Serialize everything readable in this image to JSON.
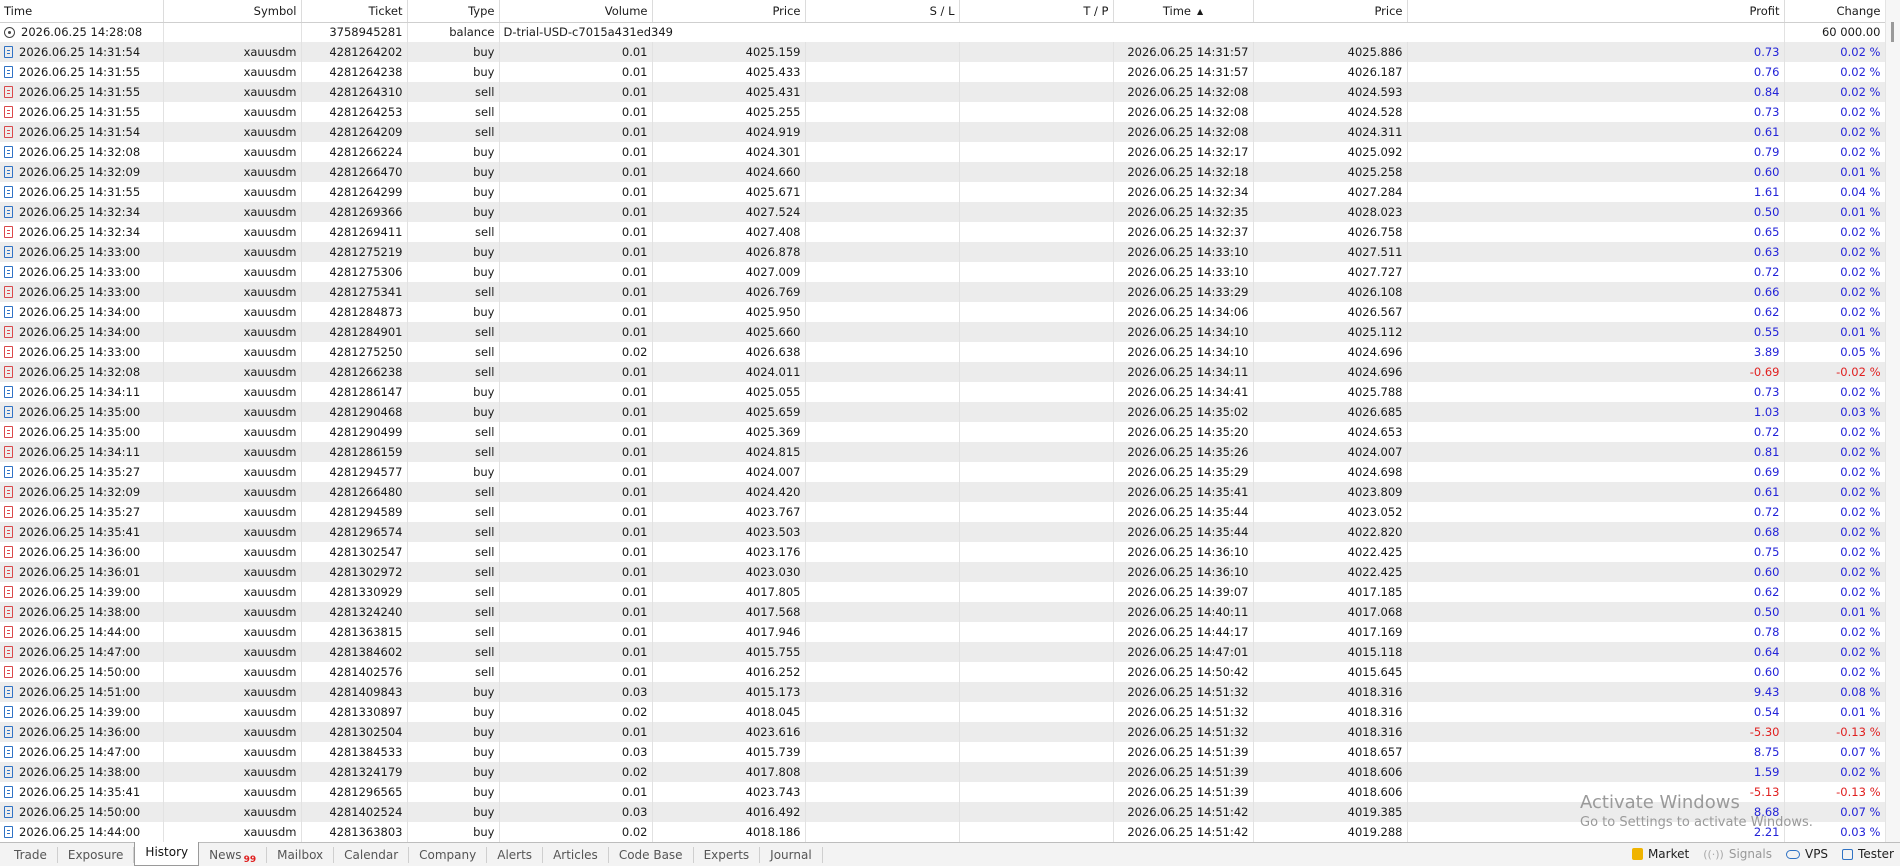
{
  "columns": [
    "Time",
    "Symbol",
    "Ticket",
    "Type",
    "Volume",
    "Price",
    "S / L",
    "T / P",
    "Time",
    "Price",
    "Profit",
    "Change"
  ],
  "sort_indicator": "▲",
  "balance_row": {
    "time": "2026.06.25 14:28:08",
    "ticket": "3758945281",
    "type": "balance",
    "comment": "D-trial-USD-c7015a431ed349",
    "profit": "60 000.00"
  },
  "deals": [
    {
      "open_time": "2026.06.25 14:31:54",
      "symbol": "xauusdm",
      "ticket": "4281264202",
      "type": "buy",
      "volume": "0.01",
      "open_price": "4025.159",
      "sl": "",
      "tp": "",
      "close_time": "2026.06.25 14:31:57",
      "close_price": "4025.886",
      "profit": "0.73",
      "change": "0.02 %"
    },
    {
      "open_time": "2026.06.25 14:31:55",
      "symbol": "xauusdm",
      "ticket": "4281264238",
      "type": "buy",
      "volume": "0.01",
      "open_price": "4025.433",
      "sl": "",
      "tp": "",
      "close_time": "2026.06.25 14:31:57",
      "close_price": "4026.187",
      "profit": "0.76",
      "change": "0.02 %"
    },
    {
      "open_time": "2026.06.25 14:31:55",
      "symbol": "xauusdm",
      "ticket": "4281264310",
      "type": "sell",
      "volume": "0.01",
      "open_price": "4025.431",
      "sl": "",
      "tp": "",
      "close_time": "2026.06.25 14:32:08",
      "close_price": "4024.593",
      "profit": "0.84",
      "change": "0.02 %"
    },
    {
      "open_time": "2026.06.25 14:31:55",
      "symbol": "xauusdm",
      "ticket": "4281264253",
      "type": "sell",
      "volume": "0.01",
      "open_price": "4025.255",
      "sl": "",
      "tp": "",
      "close_time": "2026.06.25 14:32:08",
      "close_price": "4024.528",
      "profit": "0.73",
      "change": "0.02 %"
    },
    {
      "open_time": "2026.06.25 14:31:54",
      "symbol": "xauusdm",
      "ticket": "4281264209",
      "type": "sell",
      "volume": "0.01",
      "open_price": "4024.919",
      "sl": "",
      "tp": "",
      "close_time": "2026.06.25 14:32:08",
      "close_price": "4024.311",
      "profit": "0.61",
      "change": "0.02 %"
    },
    {
      "open_time": "2026.06.25 14:32:08",
      "symbol": "xauusdm",
      "ticket": "4281266224",
      "type": "buy",
      "volume": "0.01",
      "open_price": "4024.301",
      "sl": "",
      "tp": "",
      "close_time": "2026.06.25 14:32:17",
      "close_price": "4025.092",
      "profit": "0.79",
      "change": "0.02 %"
    },
    {
      "open_time": "2026.06.25 14:32:09",
      "symbol": "xauusdm",
      "ticket": "4281266470",
      "type": "buy",
      "volume": "0.01",
      "open_price": "4024.660",
      "sl": "",
      "tp": "",
      "close_time": "2026.06.25 14:32:18",
      "close_price": "4025.258",
      "profit": "0.60",
      "change": "0.01 %"
    },
    {
      "open_time": "2026.06.25 14:31:55",
      "symbol": "xauusdm",
      "ticket": "4281264299",
      "type": "buy",
      "volume": "0.01",
      "open_price": "4025.671",
      "sl": "",
      "tp": "",
      "close_time": "2026.06.25 14:32:34",
      "close_price": "4027.284",
      "profit": "1.61",
      "change": "0.04 %"
    },
    {
      "open_time": "2026.06.25 14:32:34",
      "symbol": "xauusdm",
      "ticket": "4281269366",
      "type": "buy",
      "volume": "0.01",
      "open_price": "4027.524",
      "sl": "",
      "tp": "",
      "close_time": "2026.06.25 14:32:35",
      "close_price": "4028.023",
      "profit": "0.50",
      "change": "0.01 %"
    },
    {
      "open_time": "2026.06.25 14:32:34",
      "symbol": "xauusdm",
      "ticket": "4281269411",
      "type": "sell",
      "volume": "0.01",
      "open_price": "4027.408",
      "sl": "",
      "tp": "",
      "close_time": "2026.06.25 14:32:37",
      "close_price": "4026.758",
      "profit": "0.65",
      "change": "0.02 %"
    },
    {
      "open_time": "2026.06.25 14:33:00",
      "symbol": "xauusdm",
      "ticket": "4281275219",
      "type": "buy",
      "volume": "0.01",
      "open_price": "4026.878",
      "sl": "",
      "tp": "",
      "close_time": "2026.06.25 14:33:10",
      "close_price": "4027.511",
      "profit": "0.63",
      "change": "0.02 %"
    },
    {
      "open_time": "2026.06.25 14:33:00",
      "symbol": "xauusdm",
      "ticket": "4281275306",
      "type": "buy",
      "volume": "0.01",
      "open_price": "4027.009",
      "sl": "",
      "tp": "",
      "close_time": "2026.06.25 14:33:10",
      "close_price": "4027.727",
      "profit": "0.72",
      "change": "0.02 %"
    },
    {
      "open_time": "2026.06.25 14:33:00",
      "symbol": "xauusdm",
      "ticket": "4281275341",
      "type": "sell",
      "volume": "0.01",
      "open_price": "4026.769",
      "sl": "",
      "tp": "",
      "close_time": "2026.06.25 14:33:29",
      "close_price": "4026.108",
      "profit": "0.66",
      "change": "0.02 %"
    },
    {
      "open_time": "2026.06.25 14:34:00",
      "symbol": "xauusdm",
      "ticket": "4281284873",
      "type": "buy",
      "volume": "0.01",
      "open_price": "4025.950",
      "sl": "",
      "tp": "",
      "close_time": "2026.06.25 14:34:06",
      "close_price": "4026.567",
      "profit": "0.62",
      "change": "0.02 %"
    },
    {
      "open_time": "2026.06.25 14:34:00",
      "symbol": "xauusdm",
      "ticket": "4281284901",
      "type": "sell",
      "volume": "0.01",
      "open_price": "4025.660",
      "sl": "",
      "tp": "",
      "close_time": "2026.06.25 14:34:10",
      "close_price": "4025.112",
      "profit": "0.55",
      "change": "0.01 %"
    },
    {
      "open_time": "2026.06.25 14:33:00",
      "symbol": "xauusdm",
      "ticket": "4281275250",
      "type": "sell",
      "volume": "0.02",
      "open_price": "4026.638",
      "sl": "",
      "tp": "",
      "close_time": "2026.06.25 14:34:10",
      "close_price": "4024.696",
      "profit": "3.89",
      "change": "0.05 %"
    },
    {
      "open_time": "2026.06.25 14:32:08",
      "symbol": "xauusdm",
      "ticket": "4281266238",
      "type": "sell",
      "volume": "0.01",
      "open_price": "4024.011",
      "sl": "",
      "tp": "",
      "close_time": "2026.06.25 14:34:11",
      "close_price": "4024.696",
      "profit": "-0.69",
      "change": "-0.02 %"
    },
    {
      "open_time": "2026.06.25 14:34:11",
      "symbol": "xauusdm",
      "ticket": "4281286147",
      "type": "buy",
      "volume": "0.01",
      "open_price": "4025.055",
      "sl": "",
      "tp": "",
      "close_time": "2026.06.25 14:34:41",
      "close_price": "4025.788",
      "profit": "0.73",
      "change": "0.02 %"
    },
    {
      "open_time": "2026.06.25 14:35:00",
      "symbol": "xauusdm",
      "ticket": "4281290468",
      "type": "buy",
      "volume": "0.01",
      "open_price": "4025.659",
      "sl": "",
      "tp": "",
      "close_time": "2026.06.25 14:35:02",
      "close_price": "4026.685",
      "profit": "1.03",
      "change": "0.03 %"
    },
    {
      "open_time": "2026.06.25 14:35:00",
      "symbol": "xauusdm",
      "ticket": "4281290499",
      "type": "sell",
      "volume": "0.01",
      "open_price": "4025.369",
      "sl": "",
      "tp": "",
      "close_time": "2026.06.25 14:35:20",
      "close_price": "4024.653",
      "profit": "0.72",
      "change": "0.02 %"
    },
    {
      "open_time": "2026.06.25 14:34:11",
      "symbol": "xauusdm",
      "ticket": "4281286159",
      "type": "sell",
      "volume": "0.01",
      "open_price": "4024.815",
      "sl": "",
      "tp": "",
      "close_time": "2026.06.25 14:35:26",
      "close_price": "4024.007",
      "profit": "0.81",
      "change": "0.02 %"
    },
    {
      "open_time": "2026.06.25 14:35:27",
      "symbol": "xauusdm",
      "ticket": "4281294577",
      "type": "buy",
      "volume": "0.01",
      "open_price": "4024.007",
      "sl": "",
      "tp": "",
      "close_time": "2026.06.25 14:35:29",
      "close_price": "4024.698",
      "profit": "0.69",
      "change": "0.02 %"
    },
    {
      "open_time": "2026.06.25 14:32:09",
      "symbol": "xauusdm",
      "ticket": "4281266480",
      "type": "sell",
      "volume": "0.01",
      "open_price": "4024.420",
      "sl": "",
      "tp": "",
      "close_time": "2026.06.25 14:35:41",
      "close_price": "4023.809",
      "profit": "0.61",
      "change": "0.02 %"
    },
    {
      "open_time": "2026.06.25 14:35:27",
      "symbol": "xauusdm",
      "ticket": "4281294589",
      "type": "sell",
      "volume": "0.01",
      "open_price": "4023.767",
      "sl": "",
      "tp": "",
      "close_time": "2026.06.25 14:35:44",
      "close_price": "4023.052",
      "profit": "0.72",
      "change": "0.02 %"
    },
    {
      "open_time": "2026.06.25 14:35:41",
      "symbol": "xauusdm",
      "ticket": "4281296574",
      "type": "sell",
      "volume": "0.01",
      "open_price": "4023.503",
      "sl": "",
      "tp": "",
      "close_time": "2026.06.25 14:35:44",
      "close_price": "4022.820",
      "profit": "0.68",
      "change": "0.02 %"
    },
    {
      "open_time": "2026.06.25 14:36:00",
      "symbol": "xauusdm",
      "ticket": "4281302547",
      "type": "sell",
      "volume": "0.01",
      "open_price": "4023.176",
      "sl": "",
      "tp": "",
      "close_time": "2026.06.25 14:36:10",
      "close_price": "4022.425",
      "profit": "0.75",
      "change": "0.02 %"
    },
    {
      "open_time": "2026.06.25 14:36:01",
      "symbol": "xauusdm",
      "ticket": "4281302972",
      "type": "sell",
      "volume": "0.01",
      "open_price": "4023.030",
      "sl": "",
      "tp": "",
      "close_time": "2026.06.25 14:36:10",
      "close_price": "4022.425",
      "profit": "0.60",
      "change": "0.02 %"
    },
    {
      "open_time": "2026.06.25 14:39:00",
      "symbol": "xauusdm",
      "ticket": "4281330929",
      "type": "sell",
      "volume": "0.01",
      "open_price": "4017.805",
      "sl": "",
      "tp": "",
      "close_time": "2026.06.25 14:39:07",
      "close_price": "4017.185",
      "profit": "0.62",
      "change": "0.02 %"
    },
    {
      "open_time": "2026.06.25 14:38:00",
      "symbol": "xauusdm",
      "ticket": "4281324240",
      "type": "sell",
      "volume": "0.01",
      "open_price": "4017.568",
      "sl": "",
      "tp": "",
      "close_time": "2026.06.25 14:40:11",
      "close_price": "4017.068",
      "profit": "0.50",
      "change": "0.01 %"
    },
    {
      "open_time": "2026.06.25 14:44:00",
      "symbol": "xauusdm",
      "ticket": "4281363815",
      "type": "sell",
      "volume": "0.01",
      "open_price": "4017.946",
      "sl": "",
      "tp": "",
      "close_time": "2026.06.25 14:44:17",
      "close_price": "4017.169",
      "profit": "0.78",
      "change": "0.02 %"
    },
    {
      "open_time": "2026.06.25 14:47:00",
      "symbol": "xauusdm",
      "ticket": "4281384602",
      "type": "sell",
      "volume": "0.01",
      "open_price": "4015.755",
      "sl": "",
      "tp": "",
      "close_time": "2026.06.25 14:47:01",
      "close_price": "4015.118",
      "profit": "0.64",
      "change": "0.02 %"
    },
    {
      "open_time": "2026.06.25 14:50:00",
      "symbol": "xauusdm",
      "ticket": "4281402576",
      "type": "sell",
      "volume": "0.01",
      "open_price": "4016.252",
      "sl": "",
      "tp": "",
      "close_time": "2026.06.25 14:50:42",
      "close_price": "4015.645",
      "profit": "0.60",
      "change": "0.02 %"
    },
    {
      "open_time": "2026.06.25 14:51:00",
      "symbol": "xauusdm",
      "ticket": "4281409843",
      "type": "buy",
      "volume": "0.03",
      "open_price": "4015.173",
      "sl": "",
      "tp": "",
      "close_time": "2026.06.25 14:51:32",
      "close_price": "4018.316",
      "profit": "9.43",
      "change": "0.08 %"
    },
    {
      "open_time": "2026.06.25 14:39:00",
      "symbol": "xauusdm",
      "ticket": "4281330897",
      "type": "buy",
      "volume": "0.02",
      "open_price": "4018.045",
      "sl": "",
      "tp": "",
      "close_time": "2026.06.25 14:51:32",
      "close_price": "4018.316",
      "profit": "0.54",
      "change": "0.01 %"
    },
    {
      "open_time": "2026.06.25 14:36:00",
      "symbol": "xauusdm",
      "ticket": "4281302504",
      "type": "buy",
      "volume": "0.01",
      "open_price": "4023.616",
      "sl": "",
      "tp": "",
      "close_time": "2026.06.25 14:51:32",
      "close_price": "4018.316",
      "profit": "-5.30",
      "change": "-0.13 %"
    },
    {
      "open_time": "2026.06.25 14:47:00",
      "symbol": "xauusdm",
      "ticket": "4281384533",
      "type": "buy",
      "volume": "0.03",
      "open_price": "4015.739",
      "sl": "",
      "tp": "",
      "close_time": "2026.06.25 14:51:39",
      "close_price": "4018.657",
      "profit": "8.75",
      "change": "0.07 %"
    },
    {
      "open_time": "2026.06.25 14:38:00",
      "symbol": "xauusdm",
      "ticket": "4281324179",
      "type": "buy",
      "volume": "0.02",
      "open_price": "4017.808",
      "sl": "",
      "tp": "",
      "close_time": "2026.06.25 14:51:39",
      "close_price": "4018.606",
      "profit": "1.59",
      "change": "0.02 %"
    },
    {
      "open_time": "2026.06.25 14:35:41",
      "symbol": "xauusdm",
      "ticket": "4281296565",
      "type": "buy",
      "volume": "0.01",
      "open_price": "4023.743",
      "sl": "",
      "tp": "",
      "close_time": "2026.06.25 14:51:39",
      "close_price": "4018.606",
      "profit": "-5.13",
      "change": "-0.13 %"
    },
    {
      "open_time": "2026.06.25 14:50:00",
      "symbol": "xauusdm",
      "ticket": "4281402524",
      "type": "buy",
      "volume": "0.03",
      "open_price": "4016.492",
      "sl": "",
      "tp": "",
      "close_time": "2026.06.25 14:51:42",
      "close_price": "4019.385",
      "profit": "8.68",
      "change": "0.07 %"
    },
    {
      "open_time": "2026.06.25 14:44:00",
      "symbol": "xauusdm",
      "ticket": "4281363803",
      "type": "buy",
      "volume": "0.02",
      "open_price": "4018.186",
      "sl": "",
      "tp": "",
      "close_time": "2026.06.25 14:51:42",
      "close_price": "4019.288",
      "profit": "2.21",
      "change": "0.03 %"
    }
  ],
  "tabs": [
    {
      "label": "Trade",
      "badge": "",
      "active": false
    },
    {
      "label": "Exposure",
      "badge": "",
      "active": false
    },
    {
      "label": "History",
      "badge": "",
      "active": true
    },
    {
      "label": "News",
      "badge": "99",
      "active": false
    },
    {
      "label": "Mailbox",
      "badge": "",
      "active": false
    },
    {
      "label": "Calendar",
      "badge": "",
      "active": false
    },
    {
      "label": "Company",
      "badge": "",
      "active": false
    },
    {
      "label": "Alerts",
      "badge": "",
      "active": false
    },
    {
      "label": "Articles",
      "badge": "",
      "active": false
    },
    {
      "label": "Code Base",
      "badge": "",
      "active": false
    },
    {
      "label": "Experts",
      "badge": "",
      "active": false
    },
    {
      "label": "Journal",
      "badge": "",
      "active": false
    }
  ],
  "status_tools": [
    {
      "label": "Market",
      "icon": "market-icon",
      "dim": false
    },
    {
      "label": "Signals",
      "icon": "signals-icon",
      "dim": true
    },
    {
      "label": "VPS",
      "icon": "vps-icon",
      "dim": false
    },
    {
      "label": "Tester",
      "icon": "tester-icon",
      "dim": false
    }
  ],
  "watermark": {
    "title": "Activate Windows",
    "subtitle": "Go to Settings to activate Windows."
  },
  "colors": {
    "profit_positive": "#2323d8",
    "profit_negative": "#e01f1f",
    "buy_icon": "#2f72c4",
    "sell_icon": "#d9484a"
  }
}
